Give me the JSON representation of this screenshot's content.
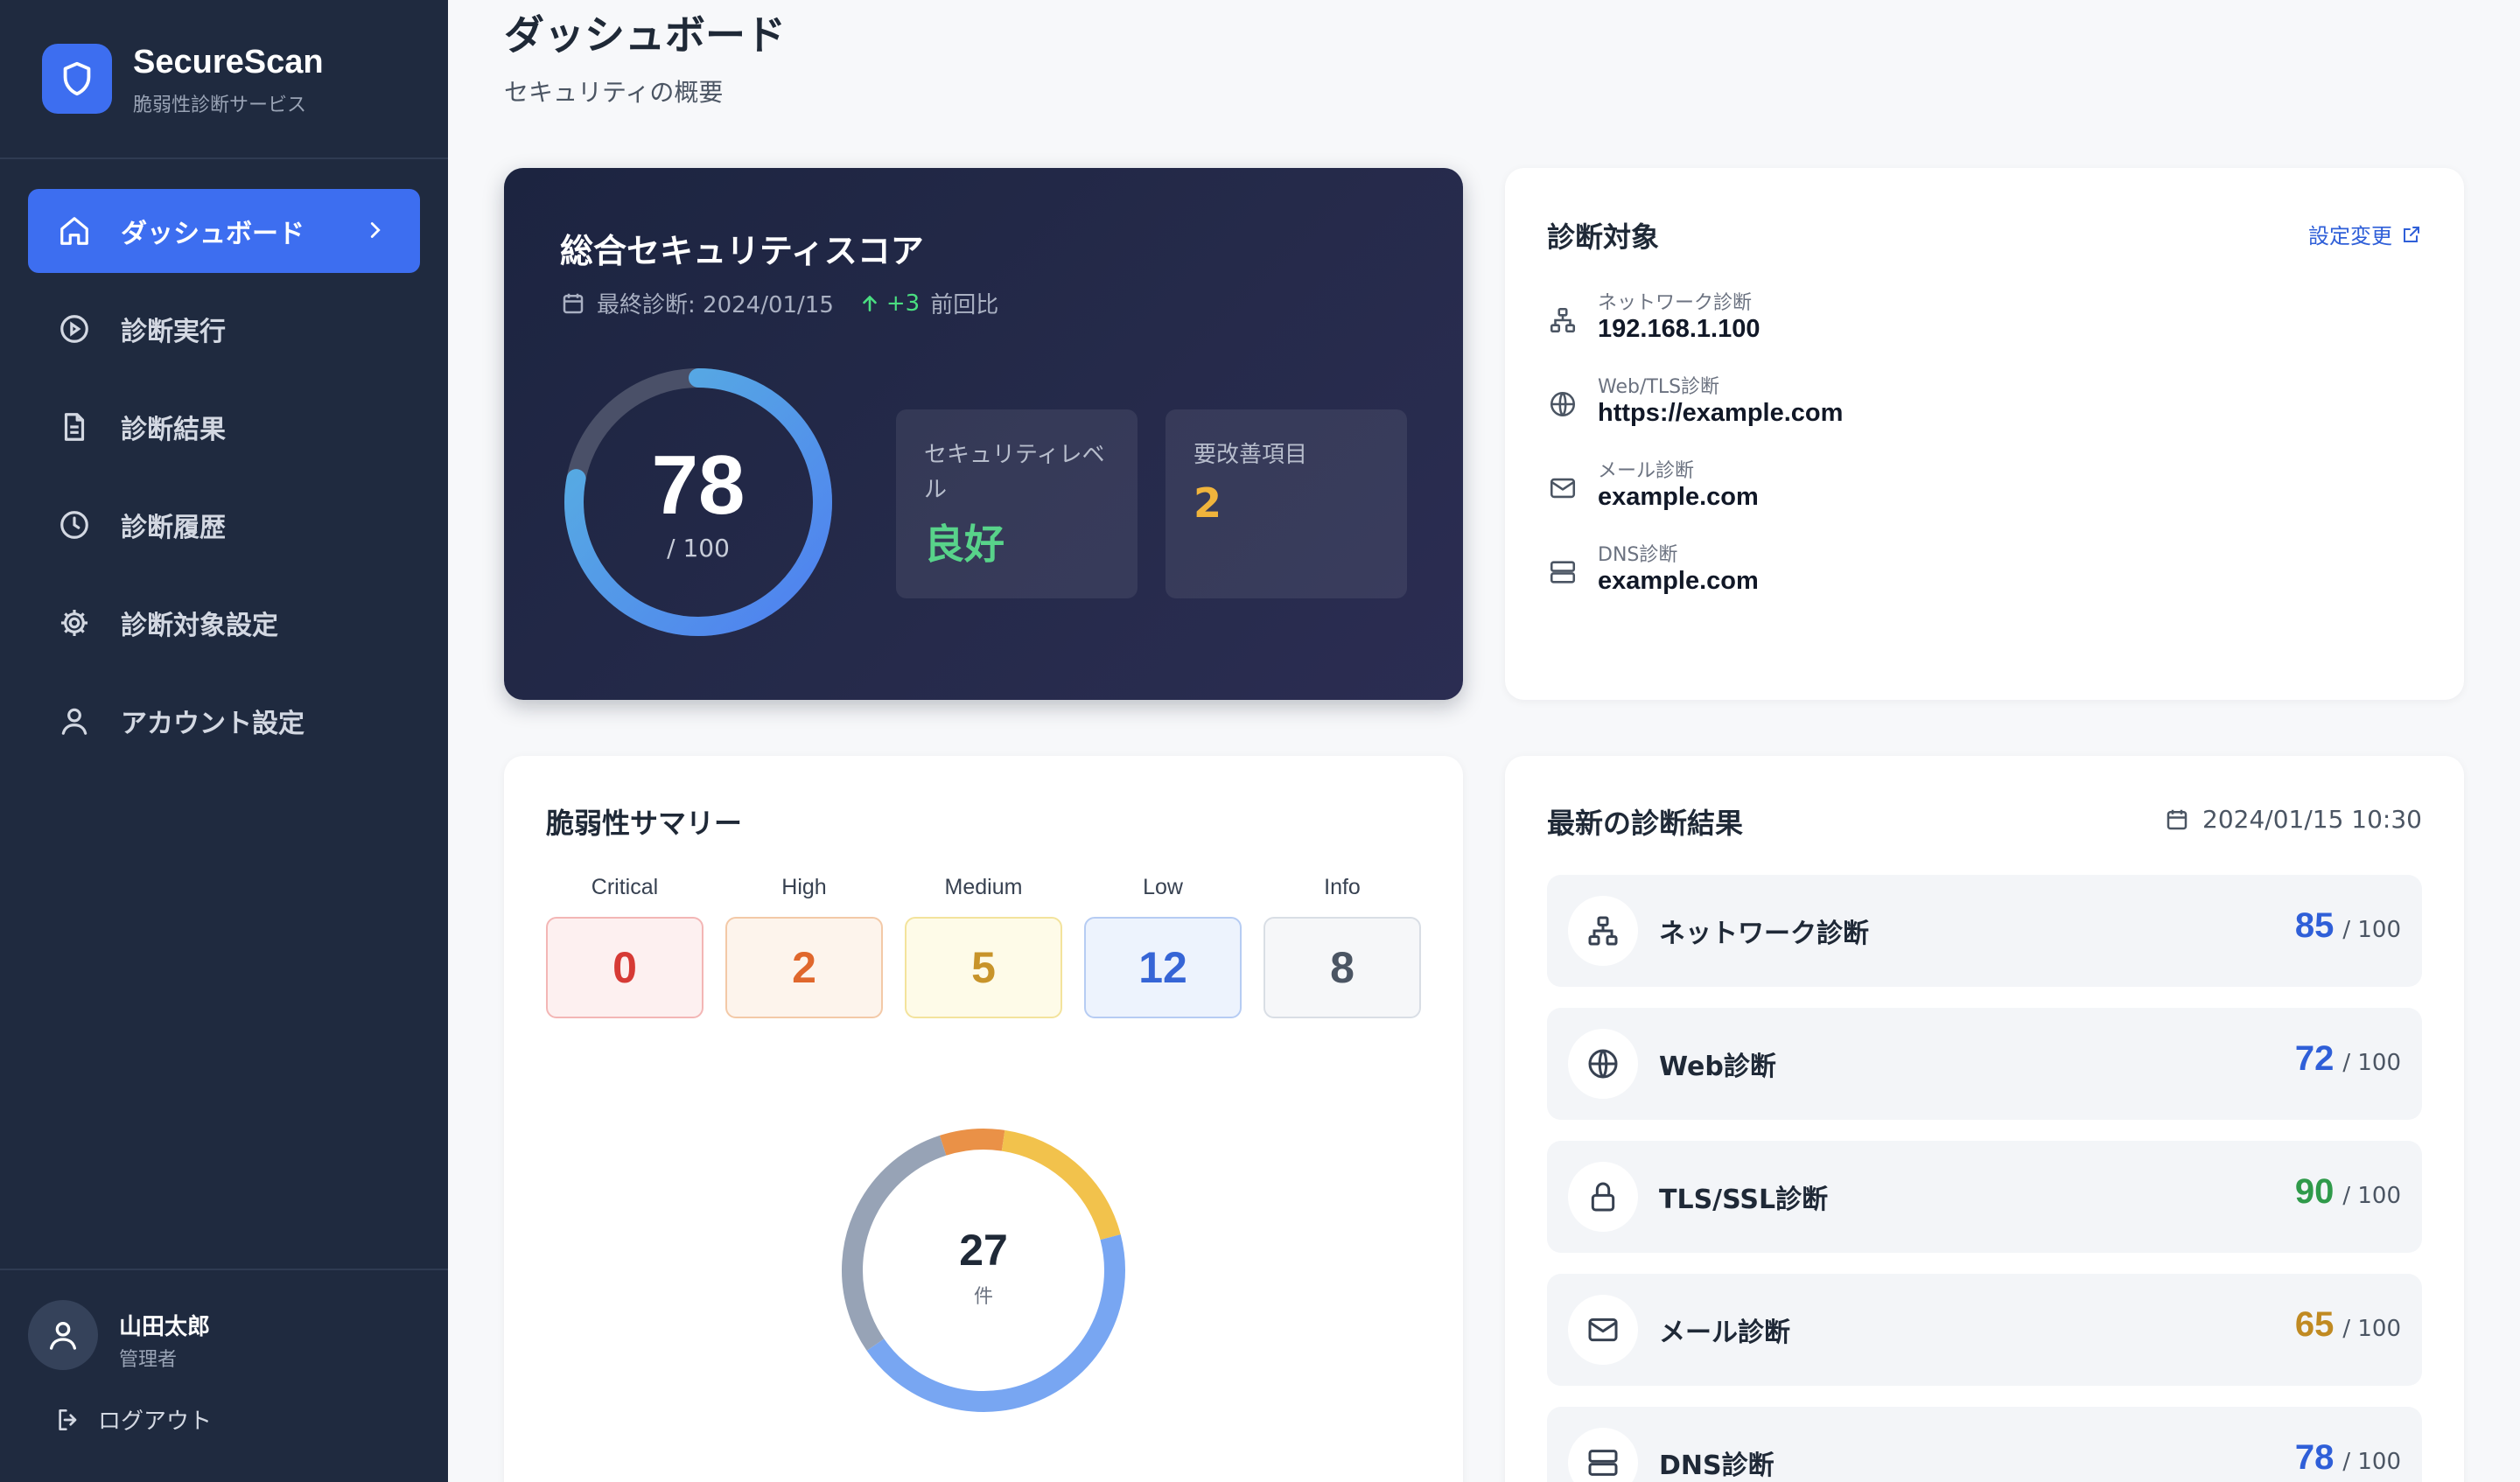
{
  "brand": {
    "name": "SecureScan",
    "subtitle": "脆弱性診断サービス"
  },
  "sidebar": {
    "items": [
      {
        "label": "ダッシュボード",
        "icon": "home-icon",
        "active": true
      },
      {
        "label": "診断実行",
        "icon": "play-circle-icon"
      },
      {
        "label": "診断結果",
        "icon": "document-icon"
      },
      {
        "label": "診断履歴",
        "icon": "clock-icon"
      },
      {
        "label": "診断対象設定",
        "icon": "gear-icon"
      },
      {
        "label": "アカウント設定",
        "icon": "user-icon"
      }
    ]
  },
  "user": {
    "name": "山田太郎",
    "role": "管理者",
    "logout_label": "ログアウト"
  },
  "header": {
    "title": "ダッシュボード",
    "subtitle": "セキュリティの概要"
  },
  "score": {
    "title": "総合セキュリティスコア",
    "last_scan": "最終診断: 2024/01/15",
    "delta": "+3",
    "delta_suffix": "前回比",
    "value": "78",
    "max": "/ 100",
    "level_label": "セキュリティレベル",
    "level_value": "良好",
    "improve_label": "要改善項目",
    "improve_value": "2",
    "colors": {
      "ring_start": "#4f7ff0",
      "ring_end": "#58b3e0",
      "level": "#58d38a",
      "improve": "#f0b43c"
    }
  },
  "targets": {
    "title": "診断対象",
    "settings_label": "設定変更",
    "items": [
      {
        "label": "ネットワーク診断",
        "value": "192.168.1.100",
        "icon": "network-icon"
      },
      {
        "label": "Web/TLS診断",
        "value": "https://example.com",
        "icon": "globe-icon"
      },
      {
        "label": "メール診断",
        "value": "example.com",
        "icon": "mail-icon"
      },
      {
        "label": "DNS診断",
        "value": "example.com",
        "icon": "server-icon"
      }
    ]
  },
  "vulnerabilities": {
    "title": "脆弱性サマリー",
    "total": "27",
    "unit": "件",
    "levels": [
      {
        "label": "Critical",
        "count": "0",
        "color": "#d63a35",
        "bg": "#fdf0f0",
        "border": "#f3b6b5"
      },
      {
        "label": "High",
        "count": "2",
        "color": "#e0672c",
        "bg": "#fdf4ec",
        "border": "#f3c9a7"
      },
      {
        "label": "Medium",
        "count": "5",
        "color": "#c8942a",
        "bg": "#fefbe8",
        "border": "#f3e39c"
      },
      {
        "label": "Low",
        "count": "12",
        "color": "#3665d6",
        "bg": "#edf3fd",
        "border": "#b6ccf3"
      },
      {
        "label": "Info",
        "count": "8",
        "color": "#4b5563",
        "bg": "#f6f7f9",
        "border": "#d9dee5"
      }
    ],
    "donut_colors": [
      "#ea9147",
      "#f2c24c",
      "#78a6f2",
      "#97a3b6"
    ]
  },
  "latest": {
    "title": "最新の診断結果",
    "date": "2024/01/15 10:30",
    "items": [
      {
        "name": "ネットワーク診断",
        "score": "85",
        "max": "/ 100",
        "icon": "network-icon",
        "color": "#2f5fd8"
      },
      {
        "name": "Web診断",
        "score": "72",
        "max": "/ 100",
        "icon": "globe-icon",
        "color": "#2f5fd8"
      },
      {
        "name": "TLS/SSL診断",
        "score": "90",
        "max": "/ 100",
        "icon": "lock-icon",
        "color": "#2f9a4a"
      },
      {
        "name": "メール診断",
        "score": "65",
        "max": "/ 100",
        "icon": "mail-icon",
        "color": "#c08a22"
      },
      {
        "name": "DNS診断",
        "score": "78",
        "max": "/ 100",
        "icon": "server-icon",
        "color": "#2f5fd8"
      }
    ]
  }
}
